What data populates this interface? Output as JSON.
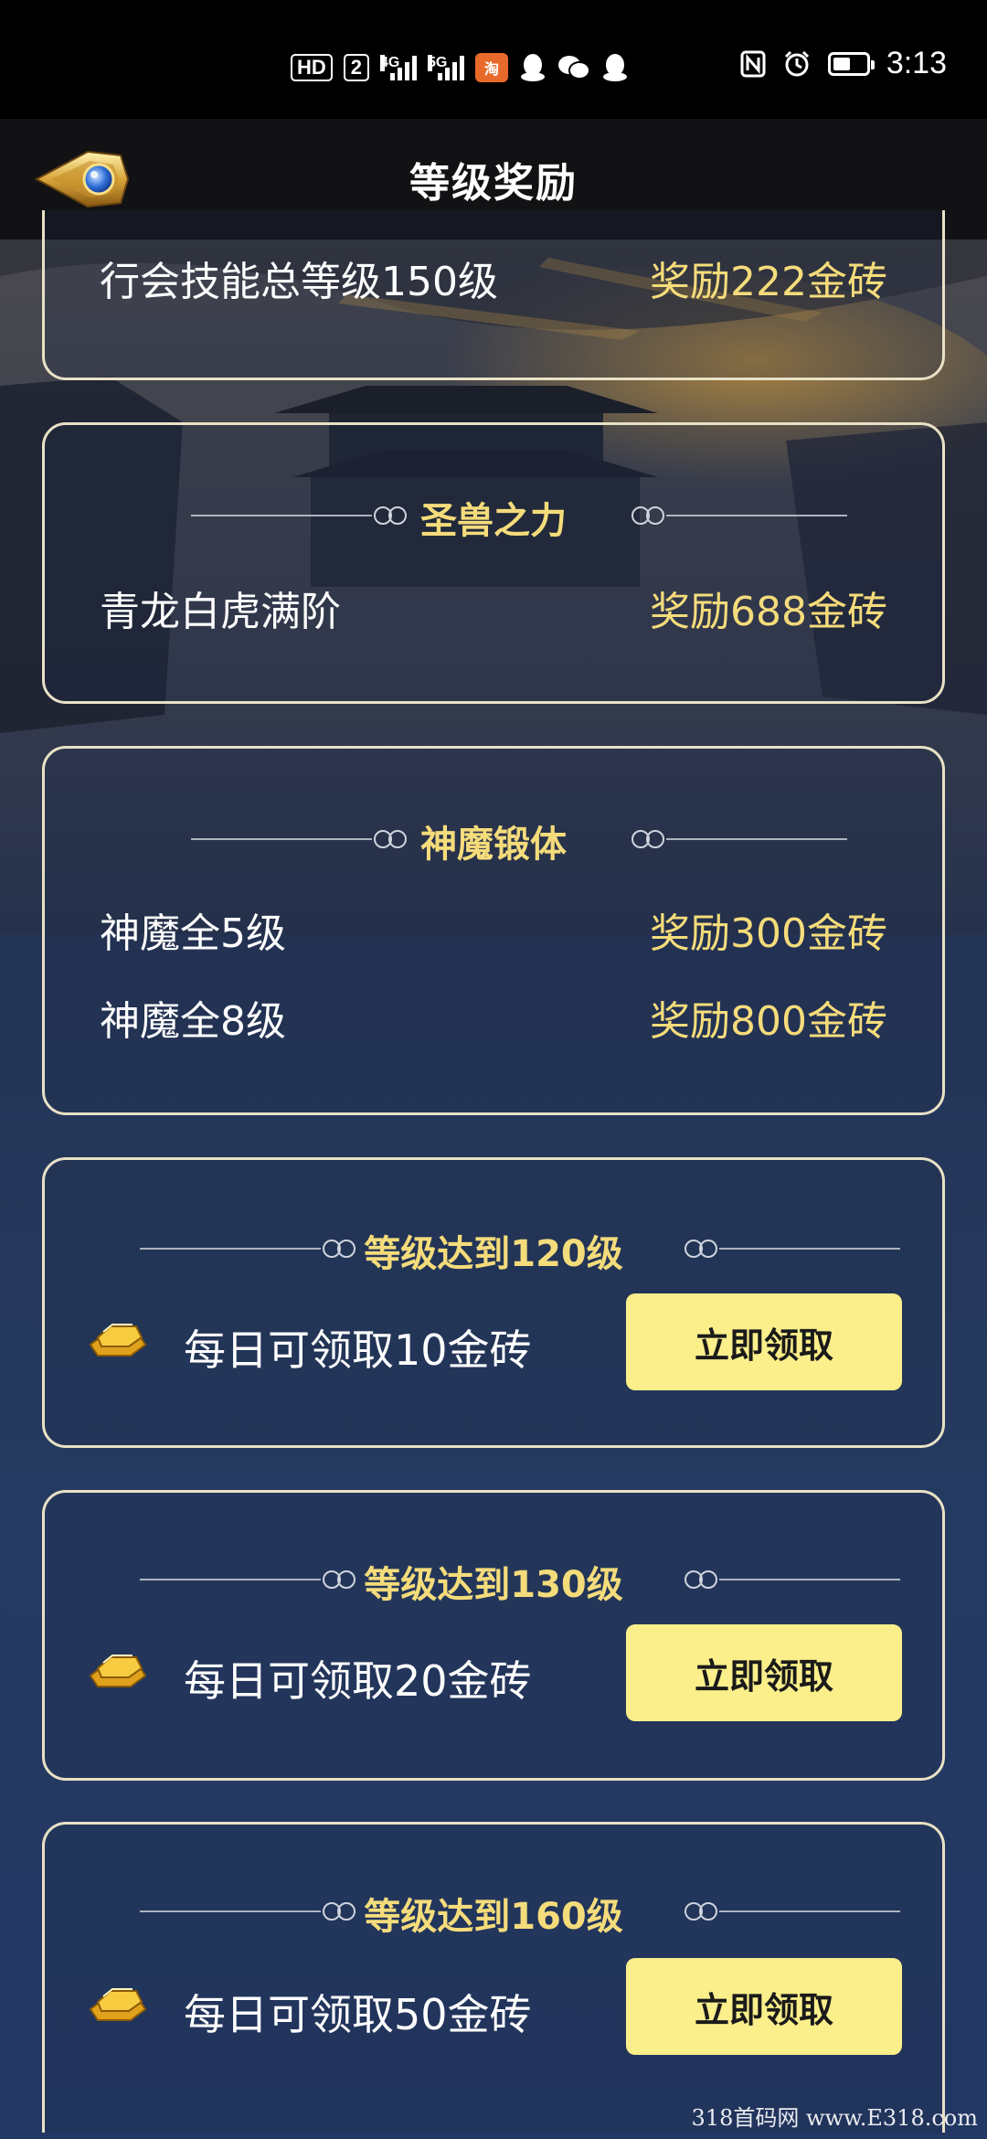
{
  "status_bar": {
    "hd_label": "HD",
    "sim_label": "2",
    "signal1_label": "4G",
    "signal2_label": "5G",
    "app_badge": "淘",
    "time": "3:13",
    "battery_level": 0.6
  },
  "header": {
    "title": "等级奖励"
  },
  "top_card": {
    "label": "行会技能总等级150级",
    "reward": "奖励222金砖"
  },
  "section_beast": {
    "title": "圣兽之力",
    "rows": [
      {
        "label": "青龙白虎满阶",
        "reward": "奖励688金砖"
      }
    ]
  },
  "section_forge": {
    "title": "神魔锻体",
    "rows": [
      {
        "label": "神魔全5级",
        "reward": "奖励300金砖"
      },
      {
        "label": "神魔全8级",
        "reward": "奖励800金砖"
      }
    ]
  },
  "level_rewards": [
    {
      "title": "等级达到120级",
      "text": "每日可领取10金砖",
      "button": "立即领取"
    },
    {
      "title": "等级达到130级",
      "text": "每日可领取20金砖",
      "button": "立即领取"
    },
    {
      "title": "等级达到160级",
      "text": "每日可领取50金砖",
      "button": "立即领取"
    }
  ],
  "watermark": "318首码网 www.E318.com",
  "colors": {
    "accent_gold": "#f5dc7b",
    "button_bg": "#fbef8b",
    "card_border": "#e9e1c6",
    "header_bg": "#121215"
  }
}
